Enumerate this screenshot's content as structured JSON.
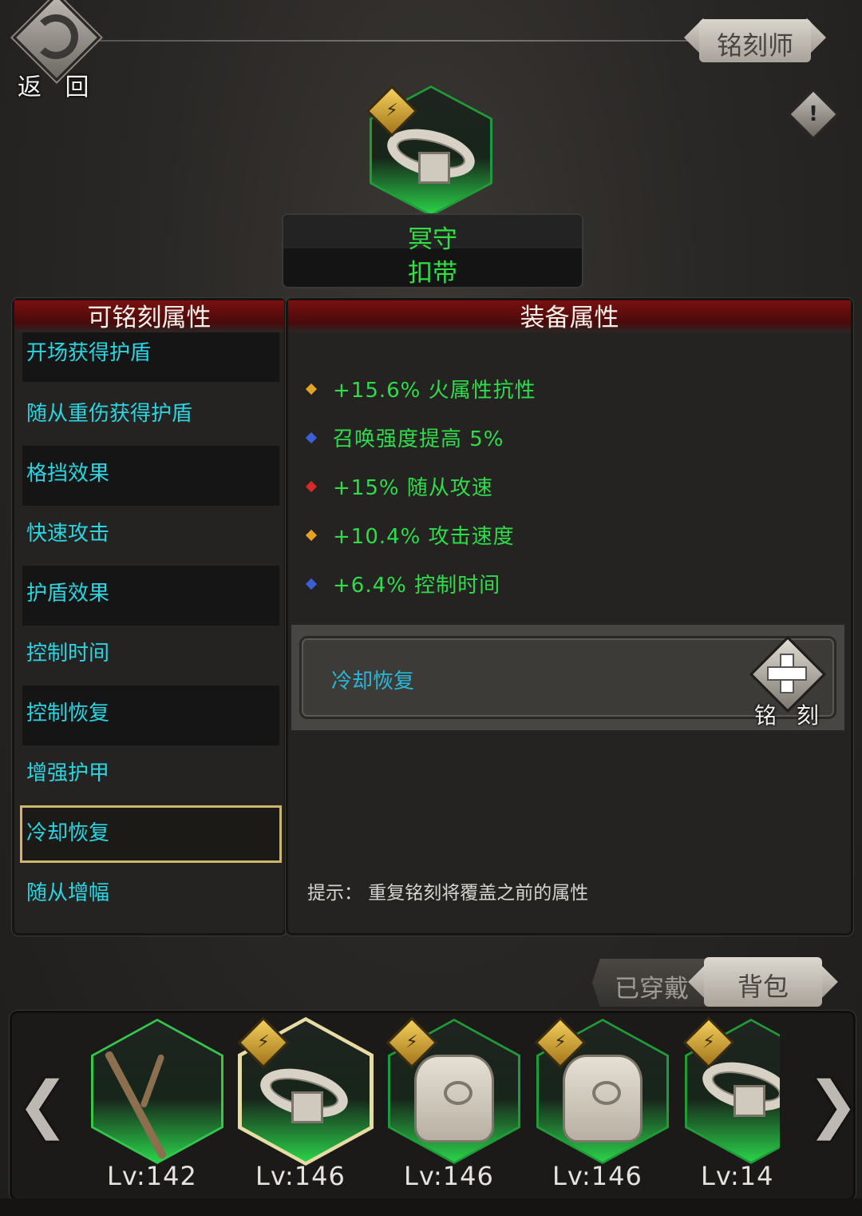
{
  "header": {
    "back_label": "返 回",
    "engraver_label": "铭刻师",
    "info_icon": "!"
  },
  "item": {
    "name_line1": "冥守",
    "name_line2": "扣带",
    "name_color": "#31e043"
  },
  "engravable": {
    "title": "可铭刻属性",
    "items": [
      {
        "label": "开场获得护盾"
      },
      {
        "label": "随从重伤获得护盾"
      },
      {
        "label": "格挡效果"
      },
      {
        "label": "快速攻击"
      },
      {
        "label": "护盾效果"
      },
      {
        "label": "控制时间"
      },
      {
        "label": "控制恢复"
      },
      {
        "label": "增强护甲"
      },
      {
        "label": "冷却恢复"
      },
      {
        "label": "随从增幅"
      }
    ],
    "selected_index": 8
  },
  "equipment": {
    "title": "装备属性",
    "stats": [
      {
        "text": "+15.6% 火属性抗性",
        "gem_color": "#e4a324"
      },
      {
        "text": "召唤强度提高 5%",
        "gem_color": "#3d5fd6"
      },
      {
        "text": "+15% 随从攻速",
        "gem_color": "#d42a2a"
      },
      {
        "text": "+10.4% 攻击速度",
        "gem_color": "#e4a324"
      },
      {
        "text": "+6.4% 控制时间",
        "gem_color": "#3d5fd6"
      }
    ],
    "engrave_slot_text": "冷却恢复",
    "engrave_button_label": "铭 刻",
    "tip": "提示：  重复铭刻将覆盖之前的属性"
  },
  "tabs": {
    "worn": "已穿戴",
    "bag": "背包"
  },
  "inventory": {
    "items": [
      {
        "level": "Lv:142",
        "icon": "twig-icon"
      },
      {
        "level": "Lv:146",
        "icon": "belt-icon"
      },
      {
        "level": "Lv:146",
        "icon": "pouch-icon"
      },
      {
        "level": "Lv:146",
        "icon": "pouch-icon"
      },
      {
        "level": "Lv:14",
        "icon": "belt-icon"
      }
    ],
    "prev_arrow": "❮",
    "next_arrow": "❯"
  }
}
